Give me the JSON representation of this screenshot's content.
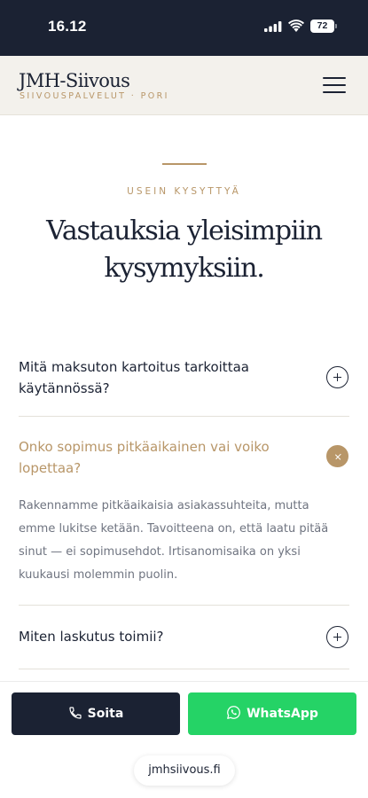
{
  "status_bar": {
    "time": "16.12",
    "battery": "72"
  },
  "header": {
    "logo": "JMH-Siivous",
    "tagline": "SIIVOUSPALVELUT · PORI"
  },
  "faq_section": {
    "eyebrow": "USEIN KYSYTTYÄ",
    "title_line1": "Vastauksia yleisimpiin",
    "title_line2": "kysymyksiin."
  },
  "faq": [
    {
      "q_line1": "Mitä maksuton kartoitus tarkoittaa",
      "q_line2": "käytännössä?",
      "expanded": false
    },
    {
      "q_line1": "Onko sopimus pitkäaikainen vai voiko",
      "q_line2": "lopettaa?",
      "expanded": true,
      "a_line1": "Rakennamme pitkäaikaisia asiakassuhteita, mutta",
      "a_line2": "emme lukitse ketään. Tavoitteena on, että laatu pitää",
      "a_line3": "sinut — ei sopimusehdot. Irtisanomisaika on yksi",
      "a_line4": "kuukausi molemmin puolin."
    },
    {
      "q_line1": "Miten laskutus toimii?",
      "expanded": false
    }
  ],
  "bottom_bar": {
    "call_label": "Soita",
    "whatsapp_label": "WhatsApp",
    "url": "jmhsiivous.fi"
  },
  "colors": {
    "navy": "#1b2233",
    "gold": "#b89668",
    "whatsapp": "#25d366",
    "cream": "#f3f1ec"
  }
}
